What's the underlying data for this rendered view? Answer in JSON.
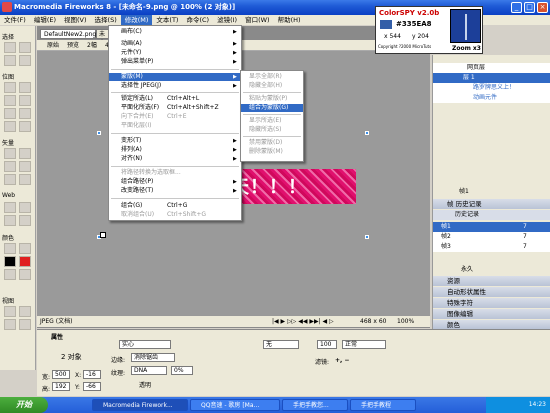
{
  "window": {
    "title": "Macromedia Fireworks 8 - [未命名-9.png @ 100% (2 对象)]",
    "controls": [
      "_",
      "□",
      "×"
    ]
  },
  "menubar": [
    "文件(F)",
    "编辑(E)",
    "视图(V)",
    "选择(S)",
    "修改(M)",
    "文本(T)",
    "命令(C)",
    "滤镜(I)",
    "窗口(W)",
    "帮助(H)"
  ],
  "tools": {
    "sections": [
      "选择",
      "位图",
      "矢量",
      "Web",
      "颜色",
      "视图"
    ]
  },
  "document": {
    "tab": "DefaultNew2.png*",
    "tab2": "未命",
    "toolbar": [
      "原始",
      "预览",
      "2幅",
      "4幅"
    ],
    "canvas_text": "天！！！",
    "status": {
      "format": "JPEG (文档)",
      "size": "468 x 60",
      "zoom": "100%"
    }
  },
  "modify_menu": {
    "items": [
      {
        "label": "画布(C)",
        "shortcut": "",
        "arrow": true,
        "disabled": false
      },
      {
        "label": "动画(A)",
        "shortcut": "",
        "arrow": true,
        "disabled": false
      },
      {
        "label": "元件(Y)",
        "shortcut": "",
        "arrow": true,
        "disabled": false
      },
      {
        "label": "弹出菜单(P)",
        "shortcut": "",
        "arrow": true,
        "disabled": false
      },
      {
        "label": "蒙版(M)",
        "shortcut": "",
        "arrow": true,
        "disabled": false,
        "highlight": true
      },
      {
        "label": "选择性 JPEG(J)",
        "shortcut": "",
        "arrow": true,
        "disabled": false
      },
      {
        "label": "锁定所选(L)",
        "shortcut": "Ctrl+Alt+L",
        "arrow": false,
        "disabled": false
      },
      {
        "label": "平面化所选(F)",
        "shortcut": "Ctrl+Alt+Shift+Z",
        "arrow": false,
        "disabled": false
      },
      {
        "label": "向下合并(E)",
        "shortcut": "Ctrl+E",
        "arrow": false,
        "disabled": true
      },
      {
        "label": "平面化层(I)",
        "shortcut": "",
        "arrow": false,
        "disabled": true
      },
      {
        "label": "变形(T)",
        "shortcut": "",
        "arrow": true,
        "disabled": false
      },
      {
        "label": "排列(A)",
        "shortcut": "",
        "arrow": true,
        "disabled": false
      },
      {
        "label": "对齐(N)",
        "shortcut": "",
        "arrow": true,
        "disabled": false
      },
      {
        "label": "将路径转换为选取框...",
        "shortcut": "",
        "arrow": false,
        "disabled": true
      },
      {
        "label": "组合路径(P)",
        "shortcut": "",
        "arrow": true,
        "disabled": false
      },
      {
        "label": "改变路径(T)",
        "shortcut": "",
        "arrow": true,
        "disabled": false
      },
      {
        "label": "组合(G)",
        "shortcut": "Ctrl+G",
        "arrow": false,
        "disabled": false
      },
      {
        "label": "取消组合(U)",
        "shortcut": "Ctrl+Shift+G",
        "arrow": false,
        "disabled": true
      }
    ]
  },
  "mask_submenu": {
    "items": [
      {
        "label": "显示全部(R)",
        "disabled": true
      },
      {
        "label": "隐藏全部(H)",
        "disabled": true
      },
      {
        "label": "粘贴为蒙版(P)",
        "disabled": true
      },
      {
        "label": "组合为蒙版(G)",
        "disabled": false,
        "highlight": true
      },
      {
        "label": "显示所选(E)",
        "disabled": true
      },
      {
        "label": "隐藏所选(S)",
        "disabled": true
      },
      {
        "label": "禁用蒙版(D)",
        "disabled": true
      },
      {
        "label": "删除蒙版(M)",
        "disabled": true
      }
    ]
  },
  "colorspy": {
    "title": "ColorSPY v2.0b",
    "hex": "#335EA8",
    "x_label": "x 544",
    "y_label": "y 204",
    "copyright": "Copyright ?2000 MicroTuts",
    "zoom": "Zoom x3",
    "swatch": "#335EA8"
  },
  "layers_panel": {
    "rows": [
      "网页层",
      "层 1",
      "路罗牌思义上！",
      "动画元件"
    ],
    "frame_row": "帧1"
  },
  "frames_panel": {
    "title": "帧 历史记录",
    "tab": "历史记录",
    "rows": [
      {
        "label": "帧1",
        "value": "7"
      },
      {
        "label": "帧2",
        "value": "7"
      },
      {
        "label": "帧3",
        "value": "7"
      }
    ],
    "loop": "永久"
  },
  "collapsed_panels": [
    "资源",
    "自动形状属性",
    "特殊字符",
    "图像编辑",
    "颜色"
  ],
  "properties": {
    "title": "属性",
    "object": "2 对象",
    "fill": "实心",
    "edge_label": "边缘:",
    "edge_value": "消除锯齿",
    "texture_label": "纹理:",
    "texture_value": "DNA",
    "texture_pct": "0%",
    "transparent": "透明",
    "stroke": "无",
    "opacity": "100",
    "blend": "正常",
    "filters_label": "滤镜:",
    "w_label": "宽:",
    "w": "500",
    "x_label": "X:",
    "x": "-16",
    "h_label": "高:",
    "h": "192",
    "y_label": "Y:",
    "y": "-66"
  },
  "taskbar": {
    "start": "开始",
    "tasks": [
      "Macromedia Firework...",
      "QQ音速 - 歌房 [Ma...",
      "手把手教您...",
      "手把手教程"
    ],
    "time": "14:23"
  }
}
